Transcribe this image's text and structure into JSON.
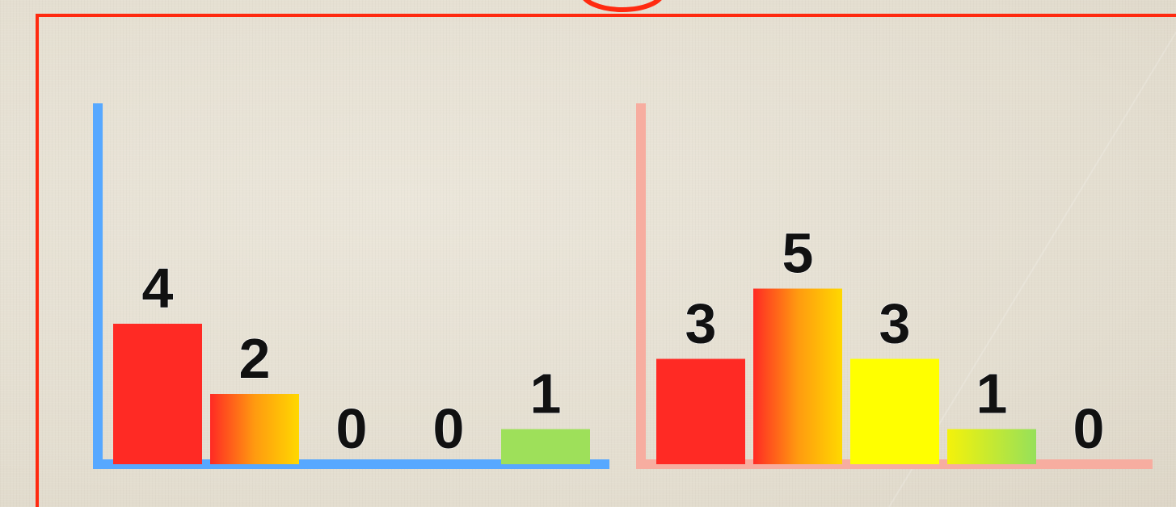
{
  "chart_data": [
    {
      "type": "bar",
      "values": [
        4,
        2,
        0,
        0,
        1
      ],
      "ylim": [
        0,
        10
      ],
      "axis_color": "#57a8ff",
      "bar_colors": [
        "#ff2a24",
        "orange-gradient",
        "#ffff00",
        "yellow-green-gradient",
        "#9ee05a"
      ]
    },
    {
      "type": "bar",
      "values": [
        3,
        5,
        3,
        1,
        0
      ],
      "ylim": [
        0,
        10
      ],
      "axis_color": "#f7ada0",
      "bar_colors": [
        "#ff2a24",
        "orange-gradient",
        "#ffff00",
        "yellow-green-gradient",
        "#9ee05a"
      ]
    }
  ],
  "colors": {
    "frame": "#ff2a10",
    "red": "#ff2a24",
    "orange": "#ffa30c",
    "yellow": "#ffff00",
    "green": "#9ee05a",
    "label": "#111111"
  }
}
